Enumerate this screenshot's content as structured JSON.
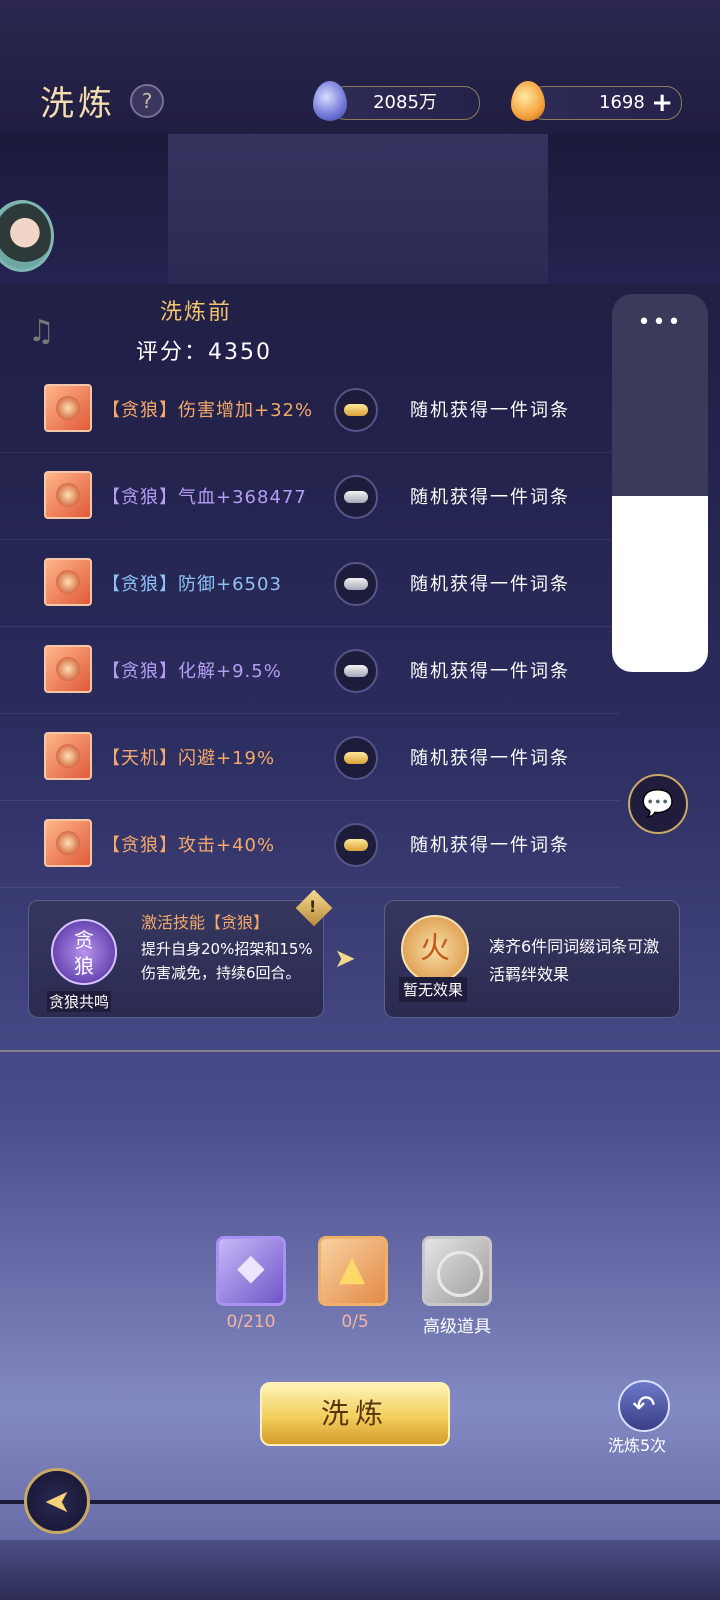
{
  "header": {
    "title": "洗炼",
    "help_symbol": "?",
    "currency_spirit": "2085万",
    "currency_gold": "1698",
    "plus_symbol": "+"
  },
  "compare": {
    "heading": "洗炼前",
    "score_label": "评分：",
    "score_value": "4350"
  },
  "rows": [
    {
      "attr": "【贪狼】伤害增加+32%",
      "color": "#f4a86a",
      "lock": "gold",
      "result": "随机获得一件词条"
    },
    {
      "attr": "【贪狼】气血+368477",
      "color": "#b59ef2",
      "lock": "silver",
      "result": "随机获得一件词条"
    },
    {
      "attr": "【贪狼】防御+6503",
      "color": "#8ec2f5",
      "lock": "silver",
      "result": "随机获得一件词条"
    },
    {
      "attr": "【贪狼】化解+9.5%",
      "color": "#b59ef2",
      "lock": "silver",
      "result": "随机获得一件词条"
    },
    {
      "attr": "【天机】闪避+19%",
      "color": "#f4a86a",
      "lock": "gold",
      "result": "随机获得一件词条"
    },
    {
      "attr": "【贪狼】攻击+40%",
      "color": "#f4a86a",
      "lock": "gold",
      "result": "随机获得一件词条"
    }
  ],
  "side_panel": {
    "dots": "•••",
    "music_icon": "♫"
  },
  "chat_icon": "💬",
  "skill_card": {
    "icon_text_top": "贪",
    "icon_text_bottom": "狼",
    "label": "贪狼共鸣",
    "title": "激活技能【贪狼】",
    "desc": "提升自身20%招架和15%伤害减免，持续6回合。",
    "warn_mark": "!"
  },
  "arrow": "➤",
  "bond_card": {
    "label": "暂无效果",
    "desc": "凑齐6件同词缀词条可激活羁绊效果",
    "icon_glyph": "火"
  },
  "props": [
    {
      "count": "0/210"
    },
    {
      "count": "0/5"
    },
    {
      "count": "高级道具"
    }
  ],
  "actions": {
    "wash_button": "洗炼",
    "undo_icon": "↶",
    "undo_label": "洗炼5次",
    "back_icon": "➤"
  }
}
